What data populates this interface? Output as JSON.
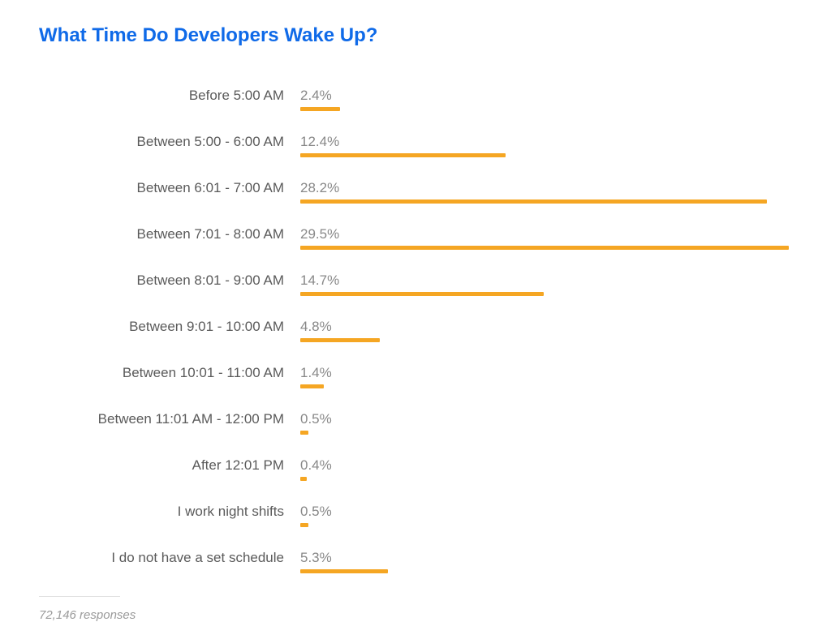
{
  "chart_data": {
    "type": "bar",
    "title": "What Time Do Developers Wake Up?",
    "categories": [
      "Before 5:00 AM",
      "Between 5:00 - 6:00 AM",
      "Between 6:01 - 7:00 AM",
      "Between 7:01 - 8:00 AM",
      "Between 8:01 - 9:00 AM",
      "Between 9:01 - 10:00 AM",
      "Between 10:01 - 11:00 AM",
      "Between 11:01 AM - 12:00 PM",
      "After 12:01 PM",
      "I work night shifts",
      "I do not have a set schedule"
    ],
    "values": [
      2.4,
      12.4,
      28.2,
      29.5,
      14.7,
      4.8,
      1.4,
      0.5,
      0.4,
      0.5,
      5.3
    ],
    "value_labels": [
      "2.4%",
      "12.4%",
      "28.2%",
      "29.5%",
      "14.7%",
      "4.8%",
      "1.4%",
      "0.5%",
      "0.4%",
      "0.5%",
      "5.3%"
    ],
    "xlim": [
      0,
      30
    ],
    "responses_note": "72,146 responses",
    "bar_color": "#f5a623",
    "title_color": "#0f6ae8"
  }
}
